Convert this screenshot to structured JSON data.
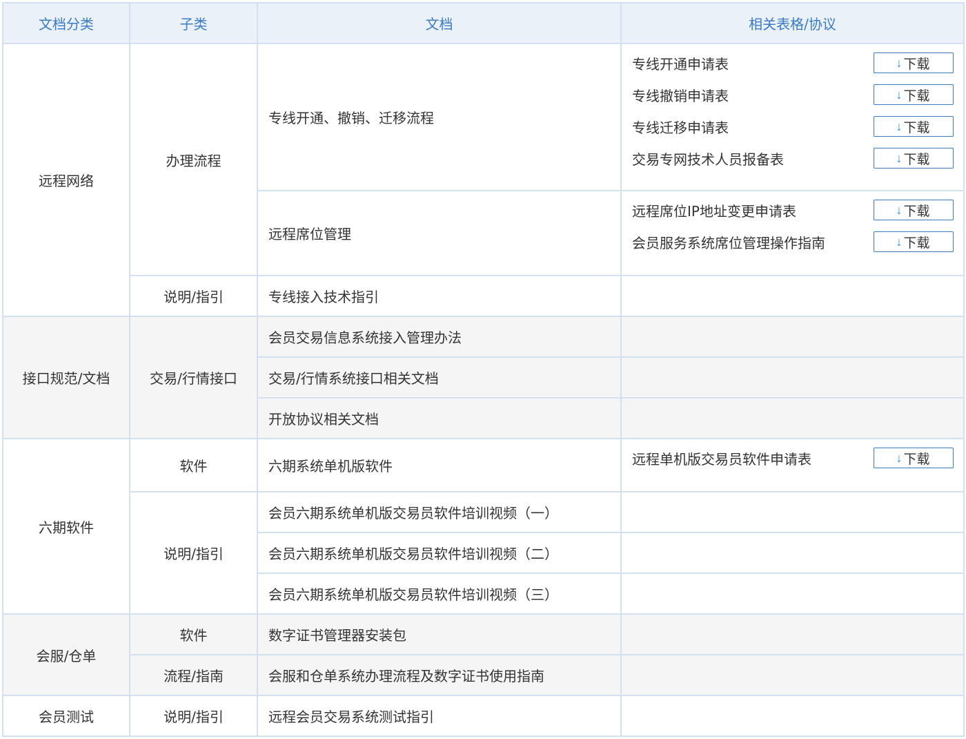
{
  "headers": {
    "category": "文档分类",
    "subcategory": "子类",
    "document": "文档",
    "forms": "相关表格/协议"
  },
  "download_label": "下载",
  "download_icon": "arrow-down-icon",
  "colors": {
    "header_text": "#3a7bc7",
    "header_bg": "#ebf1f8",
    "border": "#d3e0ef",
    "alt_row_bg": "#f5f5f5",
    "arrow": "#2f8ad8"
  },
  "groups": {
    "remote": {
      "category": "远程网络",
      "sub_process": "办理流程",
      "sub_guide": "说明/指引",
      "doc_line": "专线开通、撤销、迁移流程",
      "doc_seat": "远程席位管理",
      "doc_tech": "专线接入技术指引",
      "forms_line": [
        "专线开通申请表",
        "专线撤销申请表",
        "专线迁移申请表",
        "交易专网技术人员报备表"
      ],
      "forms_seat": [
        "远程席位IP地址变更申请表",
        "会员服务系统席位管理操作指南"
      ]
    },
    "interface": {
      "category": "接口规范/文档",
      "sub": "交易/行情接口",
      "docs": [
        "会员交易信息系统接入管理办法",
        "交易/行情系统接口相关文档",
        "开放协议相关文档"
      ]
    },
    "six": {
      "category": "六期软件",
      "sub_software": "软件",
      "sub_guide": "说明/指引",
      "doc_software": "六期系统单机版软件",
      "form_software": "远程单机版交易员软件申请表",
      "videos": [
        "会员六期系统单机版交易员软件培训视频（一）",
        "会员六期系统单机版交易员软件培训视频（二）",
        "会员六期系统单机版交易员软件培训视频（三）"
      ]
    },
    "service": {
      "category": "会服/仓单",
      "sub_software": "软件",
      "sub_process": "流程/指南",
      "doc_software": "数字证书管理器安装包",
      "doc_process": "会服和仓单系统办理流程及数字证书使用指南"
    },
    "test": {
      "category": "会员测试",
      "sub": "说明/指引",
      "doc": "远程会员交易系统测试指引"
    }
  }
}
